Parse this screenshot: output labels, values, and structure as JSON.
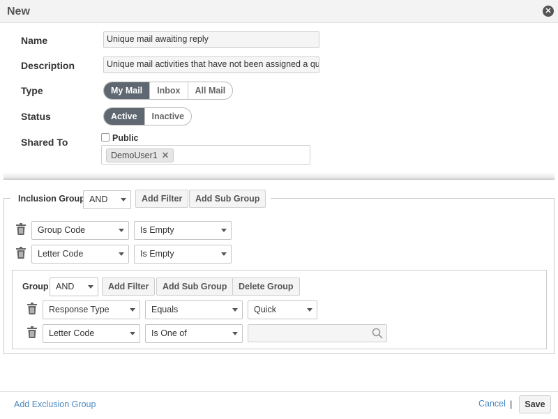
{
  "dialog": {
    "title": "New"
  },
  "form": {
    "name_label": "Name",
    "name_value": "Unique mail awaiting reply",
    "description_label": "Description",
    "description_value": "Unique mail activities that have not been assigned a quick",
    "type_label": "Type",
    "type_options": [
      "My Mail",
      "Inbox",
      "All Mail"
    ],
    "type_selected": "My Mail",
    "status_label": "Status",
    "status_options": [
      "Active",
      "Inactive"
    ],
    "status_selected": "Active",
    "shared_label": "Shared To",
    "public_label": "Public",
    "public_checked": false,
    "shared_tag": "DemoUser1"
  },
  "inclusion_group": {
    "label": "Inclusion Group",
    "operator": "AND",
    "add_filter_label": "Add Filter",
    "add_sub_group_label": "Add Sub Group",
    "filters": [
      {
        "field": "Group Code",
        "condition": "Is Empty"
      },
      {
        "field": "Letter Code",
        "condition": "Is Empty"
      }
    ],
    "sub_group": {
      "label": "Group",
      "operator": "AND",
      "add_filter_label": "Add Filter",
      "add_sub_group_label": "Add Sub Group",
      "delete_group_label": "Delete Group",
      "filters": [
        {
          "field": "Response Type",
          "condition": "Equals",
          "value": "Quick"
        },
        {
          "field": "Letter Code",
          "condition": "Is One of",
          "value": ""
        }
      ]
    }
  },
  "footer": {
    "add_exclusion_label": "Add Exclusion Group",
    "cancel_label": "Cancel",
    "separator": "|",
    "save_label": "Save"
  },
  "icons": {
    "close": "close-icon",
    "trash": "trash-icon",
    "search": "search-icon",
    "caret": "chevron-down-icon",
    "remove_tag": "remove-tag-icon"
  },
  "colors": {
    "selected_segment": "#5f6770",
    "link": "#4a88c2"
  }
}
